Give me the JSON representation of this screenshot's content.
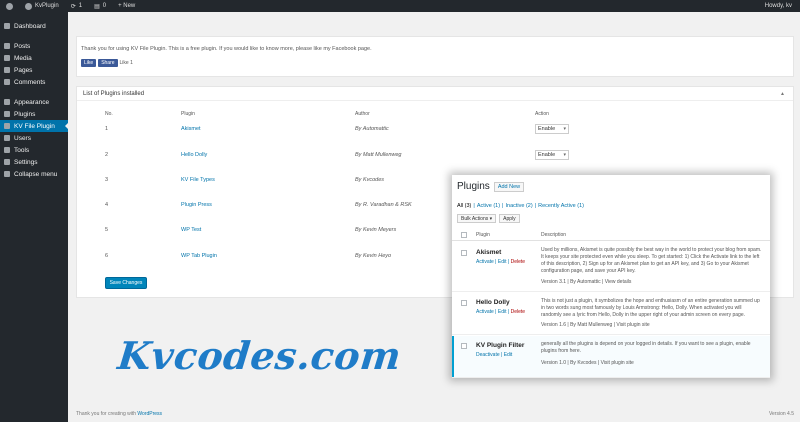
{
  "admin_bar": {
    "site_name": "KvPlugin",
    "updates": "1",
    "comments": "0",
    "new_label": "+ New",
    "howdy": "Howdy, kv"
  },
  "sidebar": {
    "items": [
      {
        "label": "Dashboard",
        "icon": "dashboard-icon"
      },
      {
        "label": "Posts",
        "icon": "pin-icon"
      },
      {
        "label": "Media",
        "icon": "media-icon"
      },
      {
        "label": "Pages",
        "icon": "page-icon"
      },
      {
        "label": "Comments",
        "icon": "comment-icon"
      },
      {
        "label": "Appearance",
        "icon": "brush-icon"
      },
      {
        "label": "Plugins",
        "icon": "plug-icon"
      },
      {
        "label": "KV File Plugin",
        "icon": "plugin-menu-icon",
        "active": true
      },
      {
        "label": "Users",
        "icon": "users-icon"
      },
      {
        "label": "Tools",
        "icon": "wrench-icon"
      },
      {
        "label": "Settings",
        "icon": "settings-icon"
      },
      {
        "label": "Collapse menu",
        "icon": "collapse-icon"
      }
    ]
  },
  "notice": {
    "text": "Thank you for using KV File Plugin. This is a free plugin. If you would like to know more, please like my Facebook page.",
    "like_label": "Like",
    "share_label": "Share",
    "count": "Like 1"
  },
  "panel": {
    "title": "List of Plugins installed",
    "toggle": "▲",
    "headers": {
      "no": "No.",
      "plugin": "Plugin",
      "author": "Author",
      "action": "Action"
    },
    "rows": [
      {
        "no": "1",
        "plugin": "Akismet",
        "author": "By Automattic",
        "action": "Enable"
      },
      {
        "no": "2",
        "plugin": "Hello Dolly",
        "author": "By Matt Mullenweg",
        "action": "Enable"
      },
      {
        "no": "3",
        "plugin": "KV File Types",
        "author": "By Kvcodes",
        "action": ""
      },
      {
        "no": "4",
        "plugin": "Plugin Press",
        "author": "By R. Varadhan & RSK",
        "action": ""
      },
      {
        "no": "5",
        "plugin": "WP Test",
        "author": "By Kevin Meyers",
        "action": ""
      },
      {
        "no": "6",
        "plugin": "WP Tab Plugin",
        "author": "By Kevin Heyo",
        "action": ""
      }
    ],
    "save_label": "Save Changes"
  },
  "footer": {
    "text": "Thank you for creating with ",
    "link": "WordPress",
    "version": "Version 4.5"
  },
  "watermark": "Kvcodes.com",
  "overlay": {
    "title": "Plugins",
    "add_new": "Add New",
    "filters": [
      {
        "label": "All (3)",
        "current": true
      },
      {
        "label": "Active (1)"
      },
      {
        "label": "Inactive (2)"
      },
      {
        "label": "Recently Active (1)"
      }
    ],
    "bulk_label": "Bulk Actions",
    "apply_label": "Apply",
    "col_plugin": "Plugin",
    "col_description": "Description",
    "plugins": [
      {
        "name": "Akismet",
        "actions": [
          "Activate",
          "Edit",
          "Delete"
        ],
        "description": "Used by millions, Akismet is quite possibly the best way in the world to protect your blog from spam. It keeps your site protected even while you sleep. To get started: 1) Click the Activate link to the left of this description, 2) Sign up for an Akismet plan to get an API key, and 3) Go to your Akismet configuration page, and save your API key.",
        "meta": "Version 3.1 | By Automattic | View details"
      },
      {
        "name": "Hello Dolly",
        "actions": [
          "Activate",
          "Edit",
          "Delete"
        ],
        "description": "This is not just a plugin, it symbolizes the hope and enthusiasm of an entire generation summed up in two words sung most famously by Louis Armstrong: Hello, Dolly. When activated you will randomly see a lyric from Hello, Dolly in the upper right of your admin screen on every page.",
        "meta": "Version 1.6 | By Matt Mullenweg | Visit plugin site"
      },
      {
        "name": "KV Plugin Filter",
        "actions": [
          "Deactivate",
          "Edit"
        ],
        "description": "generally all the plugins is depend on your logged in details. If you want to see a plugin, enable plugins from here.",
        "meta": "Version 1.0 | By Kvcodes | Visit plugin site"
      }
    ]
  },
  "colors": {
    "admin_dark": "#23282d",
    "accent": "#0073aa",
    "watermark": "#1f7cc8"
  }
}
